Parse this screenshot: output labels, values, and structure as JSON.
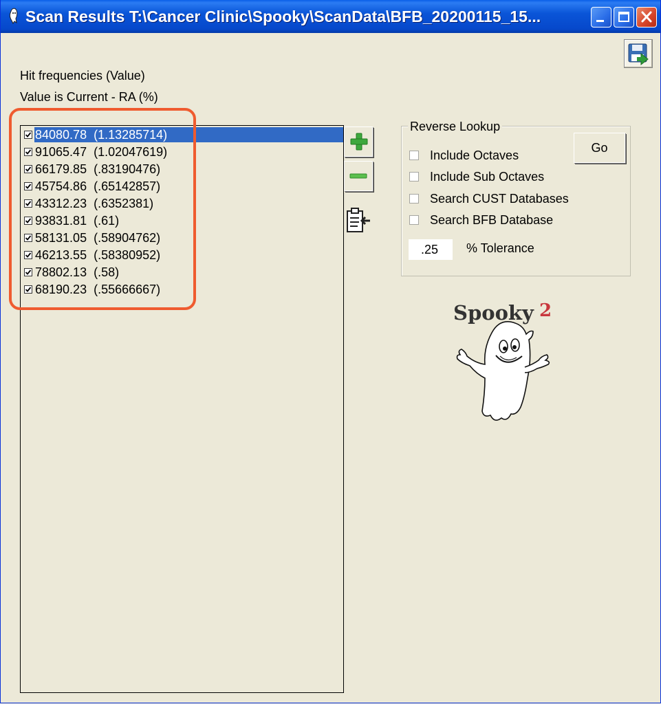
{
  "window": {
    "title": "Scan Results T:\\Cancer Clinic\\Spooky\\ScanData\\BFB_20200115_15..."
  },
  "labels": {
    "hit_frequencies": "Hit frequencies (Value)",
    "value_is": "Value is Current - RA (%)"
  },
  "results": [
    {
      "value": "84080.78",
      "pct": "(1.13285714)",
      "checked": true,
      "selected": true
    },
    {
      "value": "91065.47",
      "pct": "(1.02047619)",
      "checked": true,
      "selected": false
    },
    {
      "value": "66179.85",
      "pct": "(.83190476)",
      "checked": true,
      "selected": false
    },
    {
      "value": "45754.86",
      "pct": "(.65142857)",
      "checked": true,
      "selected": false
    },
    {
      "value": "43312.23",
      "pct": "(.6352381)",
      "checked": true,
      "selected": false
    },
    {
      "value": "93831.81",
      "pct": "(.61)",
      "checked": true,
      "selected": false
    },
    {
      "value": "58131.05",
      "pct": "(.58904762)",
      "checked": true,
      "selected": false
    },
    {
      "value": "46213.55",
      "pct": "(.58380952)",
      "checked": true,
      "selected": false
    },
    {
      "value": "78802.13",
      "pct": "(.58)",
      "checked": true,
      "selected": false
    },
    {
      "value": "68190.23",
      "pct": "(.55666667)",
      "checked": true,
      "selected": false
    }
  ],
  "reverse_lookup": {
    "title": "Reverse Lookup",
    "go_label": "Go",
    "options": [
      {
        "label": "Include Octaves",
        "checked": false
      },
      {
        "label": "Include Sub Octaves",
        "checked": false
      },
      {
        "label": "Search CUST Databases",
        "checked": false
      },
      {
        "label": "Search BFB Database",
        "checked": false
      }
    ],
    "tolerance_value": ".25",
    "tolerance_label": "% Tolerance"
  },
  "logo": {
    "text": "Spooky",
    "superscript": "2"
  },
  "colors": {
    "highlight": "#ef5b2f",
    "selection": "#316ac5",
    "window_bg": "#ece9d8",
    "plus_green": "#3ea83e"
  },
  "icons": {
    "save": "save-disk-icon",
    "add": "plus-icon",
    "remove": "minus-icon",
    "paste": "clipboard-paste-icon",
    "minimize": "minimize-icon",
    "maximize": "maximize-icon",
    "close": "close-icon"
  }
}
